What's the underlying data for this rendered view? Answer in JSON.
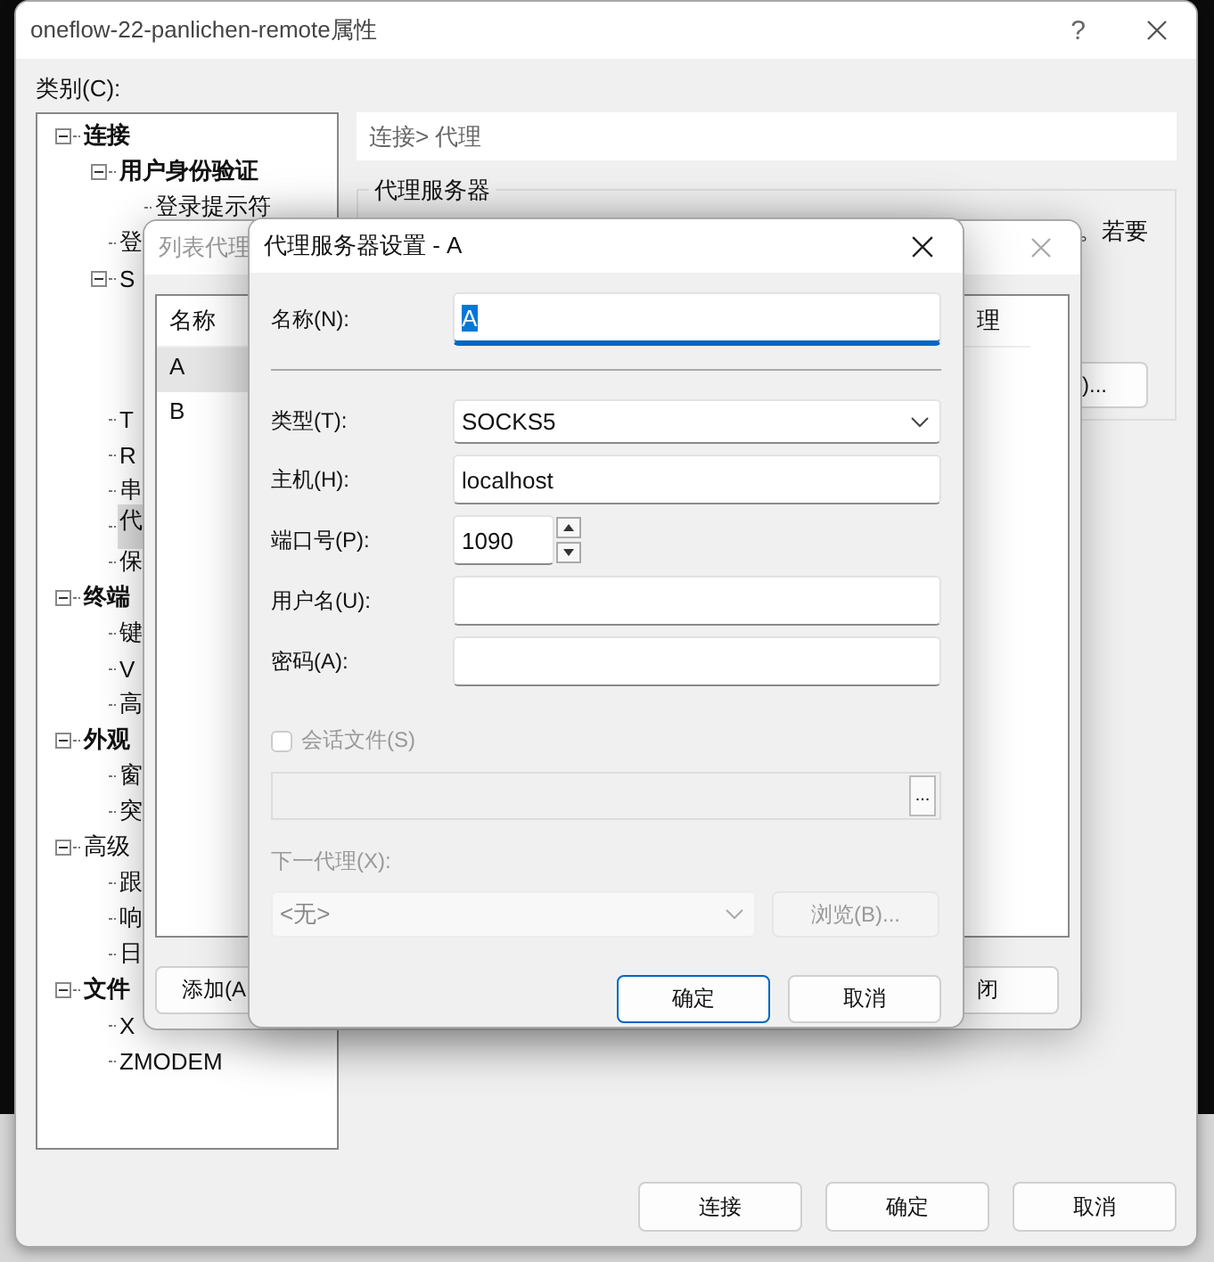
{
  "main_window": {
    "title": "oneflow-22-panlichen-remote属性",
    "help": "?",
    "category_label": "类别(C):",
    "category_tree": [
      {
        "label": "连接",
        "bold": true,
        "expanded": true,
        "selected": false,
        "children": [
          {
            "label": "用户身份验证",
            "bold": true,
            "expanded": true,
            "selected": false,
            "children": [
              {
                "label": "登录提示符",
                "selected": false
              }
            ]
          },
          {
            "label": "登",
            "selected": false
          },
          {
            "label": "S",
            "expanded": true,
            "selected": false
          },
          {
            "label": "T",
            "selected": false
          },
          {
            "label": "R",
            "selected": false
          },
          {
            "label": "串",
            "selected": false
          },
          {
            "label": "代",
            "selected": true
          },
          {
            "label": "保",
            "selected": false
          }
        ]
      },
      {
        "label": "终端",
        "bold": true,
        "expanded": true,
        "selected": false,
        "children": [
          {
            "label": "键",
            "selected": false
          },
          {
            "label": "V",
            "selected": false
          },
          {
            "label": "高",
            "selected": false
          }
        ]
      },
      {
        "label": "外观",
        "bold": true,
        "expanded": true,
        "selected": false,
        "children": [
          {
            "label": "窗",
            "selected": false
          },
          {
            "label": "突",
            "selected": false
          }
        ]
      },
      {
        "label": "高级",
        "bold": false,
        "expanded": true,
        "selected": false,
        "children": [
          {
            "label": "跟",
            "selected": false
          },
          {
            "label": "响",
            "selected": false
          },
          {
            "label": "日",
            "selected": false
          }
        ]
      },
      {
        "label": "文件",
        "bold": true,
        "expanded": true,
        "selected": false,
        "children": [
          {
            "label": "X",
            "selected": false
          },
          {
            "label": "ZMODEM",
            "selected": false
          }
        ]
      }
    ],
    "breadcrumb": "连接> 代理",
    "group_title": "代理服务器",
    "group_text": "。若要",
    "group_button": ")...",
    "buttons": [
      {
        "label": "连接"
      },
      {
        "label": "确定"
      },
      {
        "label": "取消"
      }
    ]
  },
  "list_window": {
    "title": "列表代理",
    "columns": [
      "名称",
      "理"
    ],
    "rows": [
      {
        "name": "A",
        "selected": true
      },
      {
        "name": "B",
        "selected": false
      }
    ],
    "buttons": [
      "添加(A",
      "闭"
    ]
  },
  "proxy_dialog": {
    "title": "代理服务器设置 - A",
    "fields": [
      {
        "kind": "text",
        "label": "名称(N):",
        "value": "A",
        "focused": true
      },
      {
        "kind": "select",
        "label": "类型(T):",
        "value": "SOCKS5",
        "focused": false
      },
      {
        "kind": "text",
        "label": "主机(H):",
        "value": "localhost",
        "focused": false
      },
      {
        "kind": "spin",
        "label": "端口号(P):",
        "value": "1090",
        "focused": false
      },
      {
        "kind": "text",
        "label": "用户名(U):",
        "focused": false
      },
      {
        "kind": "password",
        "label": "密码(A):",
        "focused": false
      }
    ],
    "session_file": {
      "label": "会话文件(S)",
      "checked": false,
      "disabled": true,
      "browse": "..."
    },
    "next_proxy": {
      "label": "下一代理(X):",
      "value": "<无>",
      "disabled": true,
      "browse": "浏览(B)..."
    },
    "buttons": [
      {
        "label": "确定",
        "default": true
      },
      {
        "label": "取消",
        "default": false
      }
    ]
  }
}
